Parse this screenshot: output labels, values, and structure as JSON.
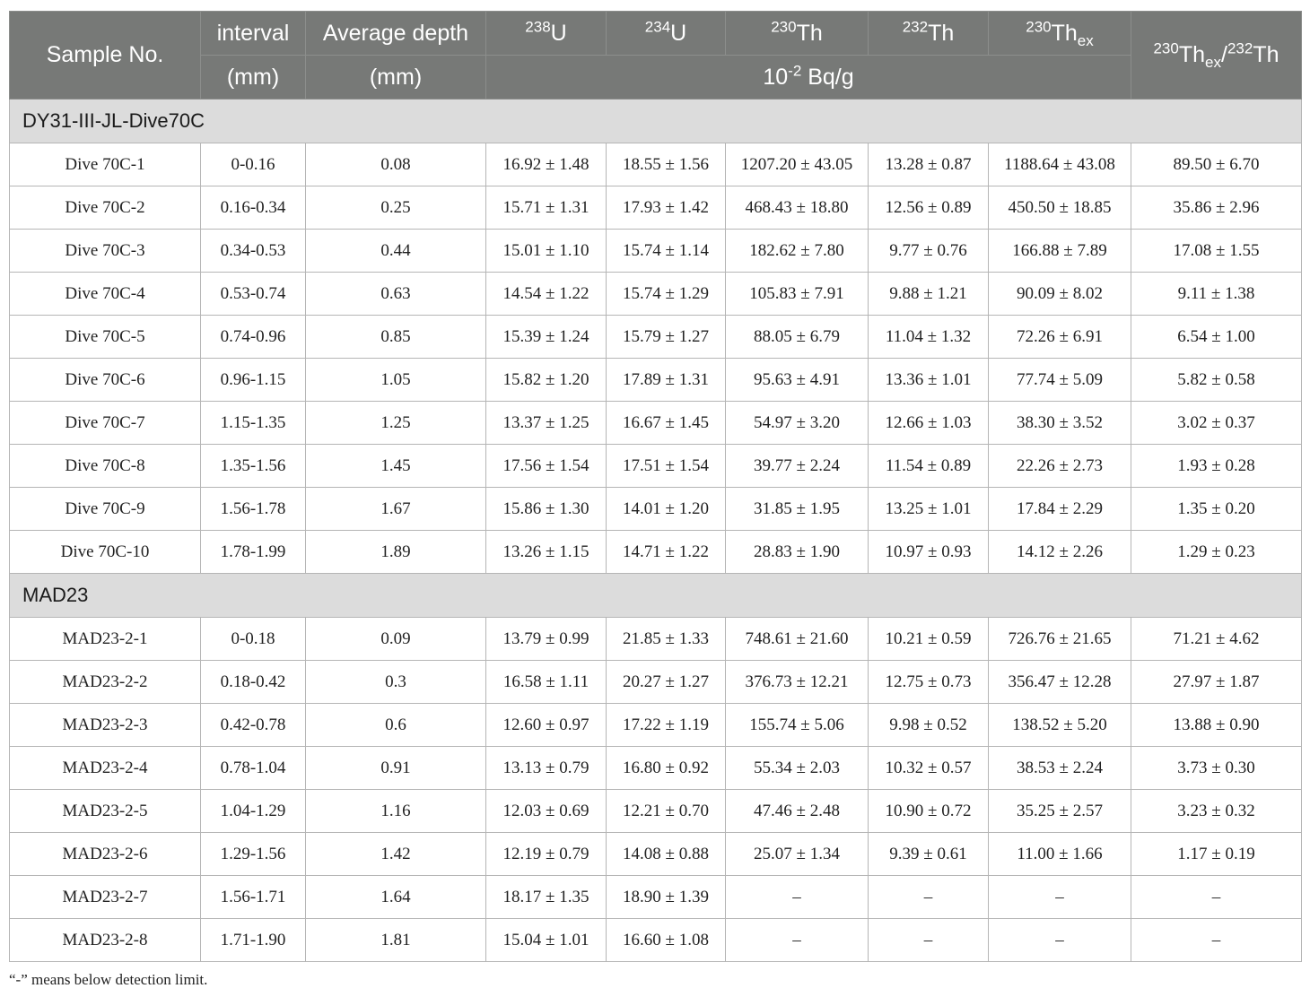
{
  "headers": {
    "sample_no": "Sample No.",
    "interval": "interval",
    "interval_unit": "(mm)",
    "avg_depth": "Average depth",
    "avg_depth_unit": "(mm)",
    "u238_sup": "238",
    "u238_el": "U",
    "u234_sup": "234",
    "u234_el": "U",
    "th230_sup": "230",
    "th230_el": "Th",
    "th232_sup": "232",
    "th232_el": "Th",
    "th230ex_sup": "230",
    "th230ex_el": "Th",
    "th230ex_sub": "ex",
    "ratio_sup1": "230",
    "ratio_el1": "Th",
    "ratio_sub": "ex",
    "ratio_slash": "/",
    "ratio_sup2": "232",
    "ratio_el2": "Th",
    "unit_base": "10",
    "unit_exp": "-2",
    "unit_rest": " Bq/g"
  },
  "sections": [
    {
      "title": "DY31-III-JL-Dive70C",
      "rows": [
        [
          "Dive 70C-1",
          "0-0.16",
          "0.08",
          "16.92 ± 1.48",
          "18.55 ± 1.56",
          "1207.20 ± 43.05",
          "13.28 ± 0.87",
          "1188.64 ± 43.08",
          "89.50 ± 6.70"
        ],
        [
          "Dive 70C-2",
          "0.16-0.34",
          "0.25",
          "15.71 ± 1.31",
          "17.93 ± 1.42",
          "468.43 ± 18.80",
          "12.56 ± 0.89",
          "450.50 ± 18.85",
          "35.86 ± 2.96"
        ],
        [
          "Dive 70C-3",
          "0.34-0.53",
          "0.44",
          "15.01 ± 1.10",
          "15.74 ± 1.14",
          "182.62 ± 7.80",
          "9.77 ± 0.76",
          "166.88 ± 7.89",
          "17.08 ± 1.55"
        ],
        [
          "Dive 70C-4",
          "0.53-0.74",
          "0.63",
          "14.54 ± 1.22",
          "15.74 ± 1.29",
          "105.83 ± 7.91",
          "9.88 ± 1.21",
          "90.09 ± 8.02",
          "9.11 ± 1.38"
        ],
        [
          "Dive 70C-5",
          "0.74-0.96",
          "0.85",
          "15.39 ± 1.24",
          "15.79 ± 1.27",
          "88.05 ± 6.79",
          "11.04 ± 1.32",
          "72.26 ± 6.91",
          "6.54 ± 1.00"
        ],
        [
          "Dive 70C-6",
          "0.96-1.15",
          "1.05",
          "15.82 ± 1.20",
          "17.89 ± 1.31",
          "95.63 ± 4.91",
          "13.36 ± 1.01",
          "77.74 ± 5.09",
          "5.82 ± 0.58"
        ],
        [
          "Dive 70C-7",
          "1.15-1.35",
          "1.25",
          "13.37 ± 1.25",
          "16.67 ± 1.45",
          "54.97 ± 3.20",
          "12.66 ± 1.03",
          "38.30 ± 3.52",
          "3.02 ± 0.37"
        ],
        [
          "Dive 70C-8",
          "1.35-1.56",
          "1.45",
          "17.56 ± 1.54",
          "17.51 ± 1.54",
          "39.77 ± 2.24",
          "11.54 ± 0.89",
          "22.26 ± 2.73",
          "1.93 ± 0.28"
        ],
        [
          "Dive 70C-9",
          "1.56-1.78",
          "1.67",
          "15.86 ± 1.30",
          "14.01 ± 1.20",
          "31.85 ± 1.95",
          "13.25 ± 1.01",
          "17.84 ± 2.29",
          "1.35 ± 0.20"
        ],
        [
          "Dive 70C-10",
          "1.78-1.99",
          "1.89",
          "13.26 ± 1.15",
          "14.71 ± 1.22",
          "28.83 ± 1.90",
          "10.97 ± 0.93",
          "14.12 ± 2.26",
          "1.29 ± 0.23"
        ]
      ]
    },
    {
      "title": "MAD23",
      "rows": [
        [
          "MAD23-2-1",
          "0-0.18",
          "0.09",
          "13.79 ± 0.99",
          "21.85 ± 1.33",
          "748.61 ± 21.60",
          "10.21 ± 0.59",
          "726.76 ± 21.65",
          "71.21 ± 4.62"
        ],
        [
          "MAD23-2-2",
          "0.18-0.42",
          "0.3",
          "16.58 ± 1.11",
          "20.27 ± 1.27",
          "376.73 ± 12.21",
          "12.75 ± 0.73",
          "356.47 ± 12.28",
          "27.97 ± 1.87"
        ],
        [
          "MAD23-2-3",
          "0.42-0.78",
          "0.6",
          "12.60 ± 0.97",
          "17.22 ± 1.19",
          "155.74 ± 5.06",
          "9.98 ± 0.52",
          "138.52 ± 5.20",
          "13.88 ± 0.90"
        ],
        [
          "MAD23-2-4",
          "0.78-1.04",
          "0.91",
          "13.13 ± 0.79",
          "16.80 ± 0.92",
          "55.34 ± 2.03",
          "10.32 ± 0.57",
          "38.53 ± 2.24",
          "3.73 ± 0.30"
        ],
        [
          "MAD23-2-5",
          "1.04-1.29",
          "1.16",
          "12.03 ± 0.69",
          "12.21 ± 0.70",
          "47.46 ± 2.48",
          "10.90 ± 0.72",
          "35.25 ± 2.57",
          "3.23 ± 0.32"
        ],
        [
          "MAD23-2-6",
          "1.29-1.56",
          "1.42",
          "12.19 ± 0.79",
          "14.08 ± 0.88",
          "25.07 ± 1.34",
          "9.39 ± 0.61",
          "11.00 ± 1.66",
          "1.17 ± 0.19"
        ],
        [
          "MAD23-2-7",
          "1.56-1.71",
          "1.64",
          "18.17 ± 1.35",
          "18.90 ± 1.39",
          "–",
          "–",
          "–",
          "–"
        ],
        [
          "MAD23-2-8",
          "1.71-1.90",
          "1.81",
          "15.04 ± 1.01",
          "16.60 ± 1.08",
          "–",
          "–",
          "–",
          "–"
        ]
      ]
    }
  ],
  "footnote": "“-” means below detection limit."
}
